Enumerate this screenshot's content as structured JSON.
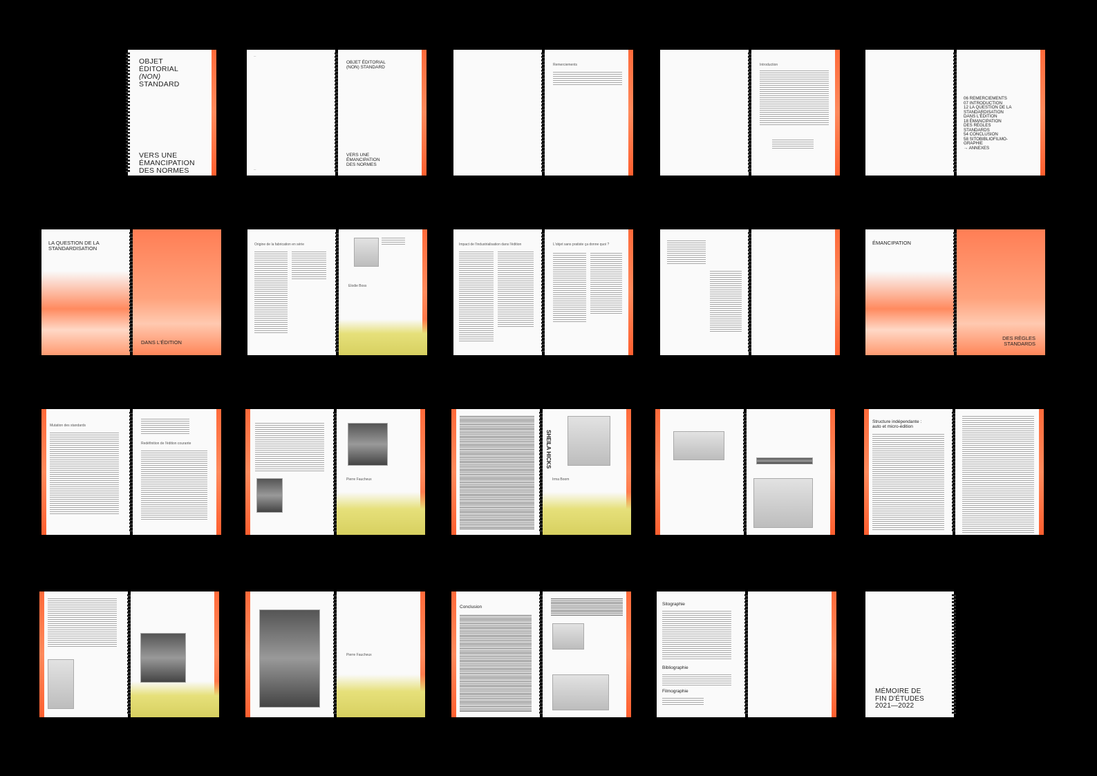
{
  "cover": {
    "title": [
      "OBJET",
      "ÉDITORIAL",
      "(NON)",
      "STANDARD"
    ],
    "subtitle": [
      "VERS UNE",
      "ÉMANCIPATION",
      "DES NORMES"
    ]
  },
  "titlepage": {
    "title": [
      "OBJET ÉDITORIAL",
      "(NON) STANDARD"
    ],
    "subtitle": [
      "VERS UNE",
      "ÉMANCIPATION",
      "DES NORMES"
    ]
  },
  "sections": {
    "remerciements": "Remerciements",
    "introduction": "Introduction",
    "question": [
      "LA QUESTION DE LA",
      "STANDARDISATION"
    ],
    "question_end": "DANS L'ÉDITION",
    "emancipation": "ÉMANCIPATION",
    "emancipation_end": [
      "DES RÈGLES",
      "STANDARDS"
    ],
    "origine": "Origine de la fabrication en série",
    "impact": "Impact de l'industrialisation dans l'édition",
    "acheter": "L'objet sans pratiste ça donne quoi ?",
    "mutation": "Mutation des standards",
    "redefinition": "Redéfinition de l'édition courante",
    "structure": [
      "Structure indépendante :",
      "auto et micro-édition"
    ],
    "conclusion": "Conclusion",
    "sitographie": "Sitographie",
    "bibliographie": "Bibliographie",
    "filmographie": "Filmographie"
  },
  "toc": [
    "06 REMERCIEMENTS",
    "07 INTRODUCTION",
    "12 LA QUESTION DE LA",
    "STANDARDISATION",
    "DANS L'ÉDITION",
    "18 ÉMANCIPATION",
    "DES RÈGLES",
    "STANDARDS",
    "54 CONCLUSION",
    "58 SITOBIBLIOFILMO-",
    "GRAPHIE",
    "→ ANNEXES"
  ],
  "captions": {
    "rotated_text": "SHEILA HICKS",
    "name_1": "Pierre Faucheux",
    "name_2": "Irma Boom",
    "name_3": "Elodie Boss"
  },
  "back": {
    "memoire": [
      "MÉMOIRE DE",
      "FIN D'ÉTUDES",
      "2021—2022"
    ]
  }
}
